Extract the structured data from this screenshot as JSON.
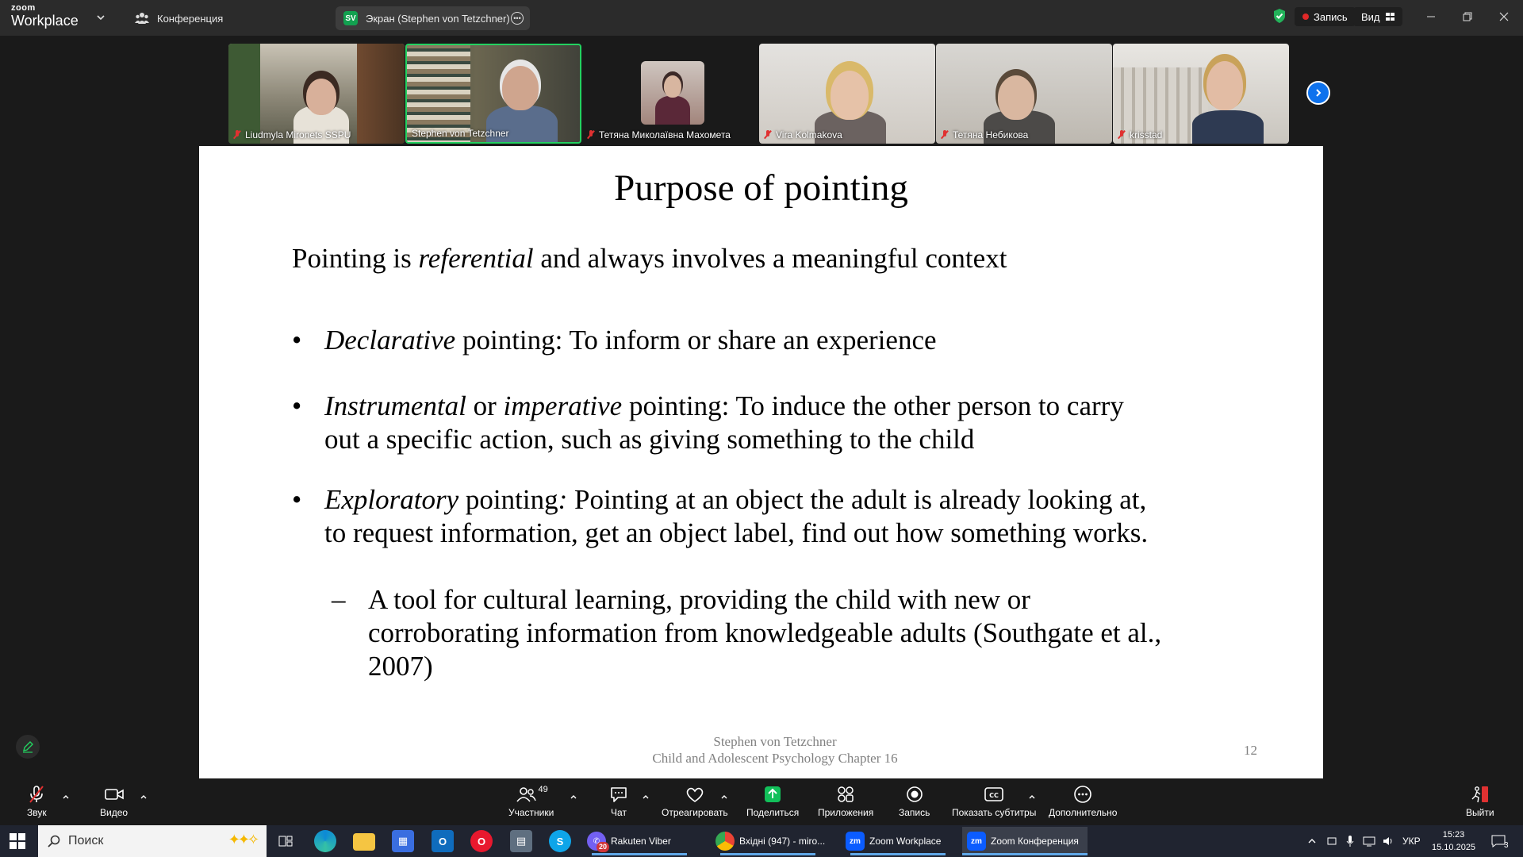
{
  "topbar": {
    "logo_line1": "zoom",
    "logo_line2": "Workplace",
    "tab_conference": "Конференция",
    "tab_screen_badge": "SV",
    "tab_screen": "Экран (Stephen von Tetzchner)",
    "recording_label": "Запись",
    "view_label": "Вид",
    "recording_color": "#e02828"
  },
  "gallery": {
    "tiles": [
      {
        "name": "Liudmyla Mironets SSPU",
        "muted": true
      },
      {
        "name": "Stephen von Tetzchner",
        "muted": false,
        "active_speaker": true
      },
      {
        "name": "Тетяна Миколаївна Махомета",
        "muted": true
      },
      {
        "name": "Vira Kolmakova",
        "muted": true
      },
      {
        "name": "Тетяна Небикова",
        "muted": true
      },
      {
        "name": "krisstad",
        "muted": true
      }
    ],
    "active_speaker_color": "#23d160"
  },
  "slide": {
    "title": "Purpose of pointing",
    "intro_a": "Pointing is ",
    "intro_em": "referential",
    "intro_b": " and always involves a meaningful context",
    "b1_em": "Declarative",
    "b1_rest": " pointing: To inform or share an experience",
    "b2_em1": "Instrumental",
    "b2_mid": " or ",
    "b2_em2": "imperative",
    "b2_rest": " pointing: To induce the other person to carry out a specific action, such as giving something to the child",
    "b3_em": "Exploratory",
    "b3_rest_a": " pointing",
    "b3_colon": ":",
    "b3_rest_b": " Pointing at an object the adult is already looking at, to request information, get an object label, find out how something works.",
    "sub_dash": "–",
    "sub_text": "A tool for cultural learning, providing the child with new or corroborating information from knowledgeable adults (Southgate et al., 2007)",
    "bullet_char": "•",
    "footer_line1": "Stephen von Tetzchner",
    "footer_line2": "Child and Adolescent Psychology Chapter 16",
    "page_number": "12"
  },
  "toolbar": {
    "audio": "Звук",
    "video": "Видео",
    "participants": "Участники",
    "participants_count": "49",
    "chat": "Чат",
    "react": "Отреагировать",
    "share": "Поделиться",
    "apps": "Приложения",
    "record": "Запись",
    "captions": "Показать субтитры",
    "more": "Дополнительно",
    "leave": "Выйти",
    "share_color": "#12c05a"
  },
  "taskbar": {
    "search_placeholder": "Поиск",
    "apps": [
      {
        "label": "Rakuten Viber",
        "badge": "20"
      },
      {
        "label": "Вхідні (947) - miro..."
      },
      {
        "label": "Zoom Workplace"
      },
      {
        "label": "Zoom Конференция",
        "active": true
      }
    ],
    "language": "УКР",
    "time": "15:23",
    "date": "15.10.2025",
    "notifications": "3"
  }
}
